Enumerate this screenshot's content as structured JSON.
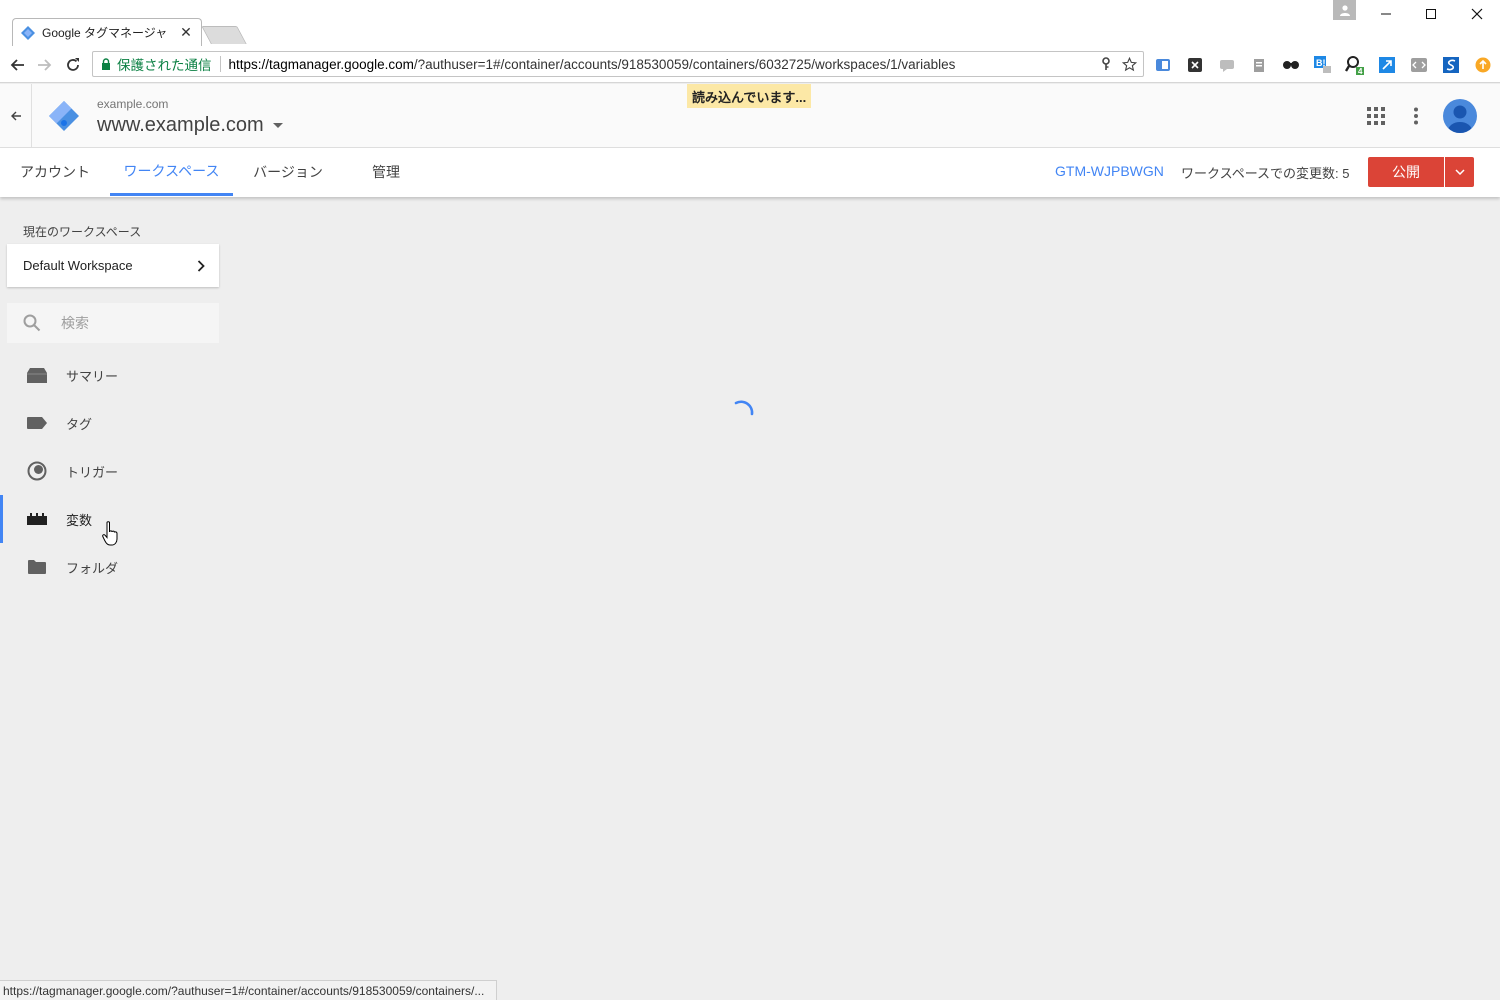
{
  "browser": {
    "tab_title": "Google タグマネージャ",
    "secure_label": "保護された通信",
    "url_host": "https://tagmanager.google.com",
    "url_rest": "/?authuser=1#/container/accounts/918530059/containers/6032725/workspaces/1/variables",
    "status_url": "https://tagmanager.google.com/?authuser=1#/container/accounts/918530059/containers/..."
  },
  "header": {
    "account": "example.com",
    "container": "www.example.com",
    "loading": "読み込んでいます..."
  },
  "nav": {
    "tabs": [
      {
        "label": "アカウント"
      },
      {
        "label": "ワークスペース"
      },
      {
        "label": "バージョン"
      },
      {
        "label": "管理"
      }
    ],
    "active_tab": "ワークスペース",
    "container_id": "GTM-WJPBWGN",
    "changes": "ワークスペースでの変更数: 5",
    "publish": "公開"
  },
  "sidebar": {
    "current_ws_label": "現在のワークスペース",
    "workspace": "Default Workspace",
    "search_placeholder": "検索",
    "items": [
      {
        "label": "サマリー",
        "icon": "summary-icon"
      },
      {
        "label": "タグ",
        "icon": "tag-icon"
      },
      {
        "label": "トリガー",
        "icon": "trigger-icon"
      },
      {
        "label": "変数",
        "icon": "variable-icon"
      },
      {
        "label": "フォルダ",
        "icon": "folder-icon"
      }
    ],
    "active_item": "変数"
  },
  "colors": {
    "accent": "#4285f4",
    "publish": "#db4437",
    "secure": "#0b8043",
    "loading_bg": "#fce8a6"
  }
}
